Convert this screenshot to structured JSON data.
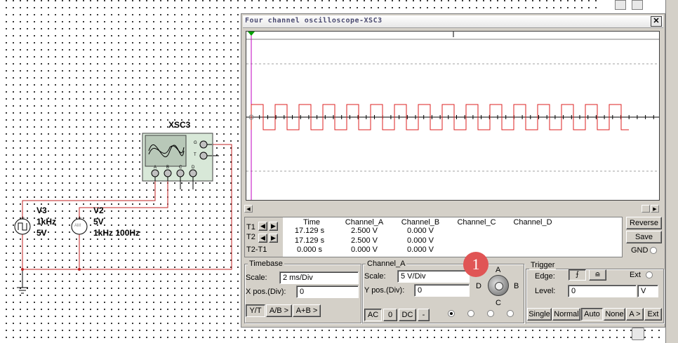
{
  "circuit": {
    "scope_label": "XSC3",
    "scope_terminals": {
      "g": "G",
      "t": "T",
      "a": "A",
      "b": "B",
      "c": "C",
      "d": "D"
    },
    "v3": {
      "name": "V3",
      "freq": "1kHz",
      "amp": "5V"
    },
    "v2": {
      "name": "V2",
      "amp": "5V",
      "freq": "1kHz 100Hz",
      "symbol": "AM"
    }
  },
  "scope": {
    "title": "Four channel oscilloscope-XSC3",
    "close_glyph": "✕",
    "trace_color": "#dd2020",
    "marker_color": "#c000c0",
    "cursor_marker": "T",
    "readout": {
      "headers": [
        "Time",
        "Channel_A",
        "Channel_B",
        "Channel_C",
        "Channel_D"
      ],
      "rows": [
        {
          "label": "T1",
          "time": "17.129 s",
          "a": "2.500 V",
          "b": "0.000 V"
        },
        {
          "label": "T2",
          "time": "17.129 s",
          "a": "2.500 V",
          "b": "0.000 V"
        },
        {
          "label": "T2-T1",
          "time": "0.000 s",
          "a": "0.000 V",
          "b": "0.000 V"
        }
      ]
    },
    "buttons": {
      "reverse": "Reverse",
      "save": "Save",
      "gnd": "GND"
    },
    "timebase": {
      "title": "Timebase",
      "scale_label": "Scale:",
      "scale_value": "2 ms/Div",
      "xpos_label": "X pos.(Div):",
      "xpos_value": "0",
      "modes": [
        "Y/T",
        "A/B >",
        "A+B >"
      ]
    },
    "channel": {
      "title": "Channel_A",
      "scale_label": "Scale:",
      "scale_value": "5  V/Div",
      "ypos_label": "Y pos.(Div):",
      "ypos_value": "0",
      "coupling": [
        "AC",
        "0",
        "DC",
        "-"
      ],
      "knob_labels": {
        "a": "A",
        "b": "B",
        "c": "C",
        "d": "D"
      }
    },
    "trigger": {
      "title": "Trigger",
      "edge_label": "Edge:",
      "ext_label": "Ext",
      "level_label": "Level:",
      "level_value": "0",
      "level_unit": "V",
      "modes": [
        "Single",
        "Normal",
        "Auto",
        "None",
        "A >",
        "Ext"
      ]
    },
    "badge": "1"
  }
}
